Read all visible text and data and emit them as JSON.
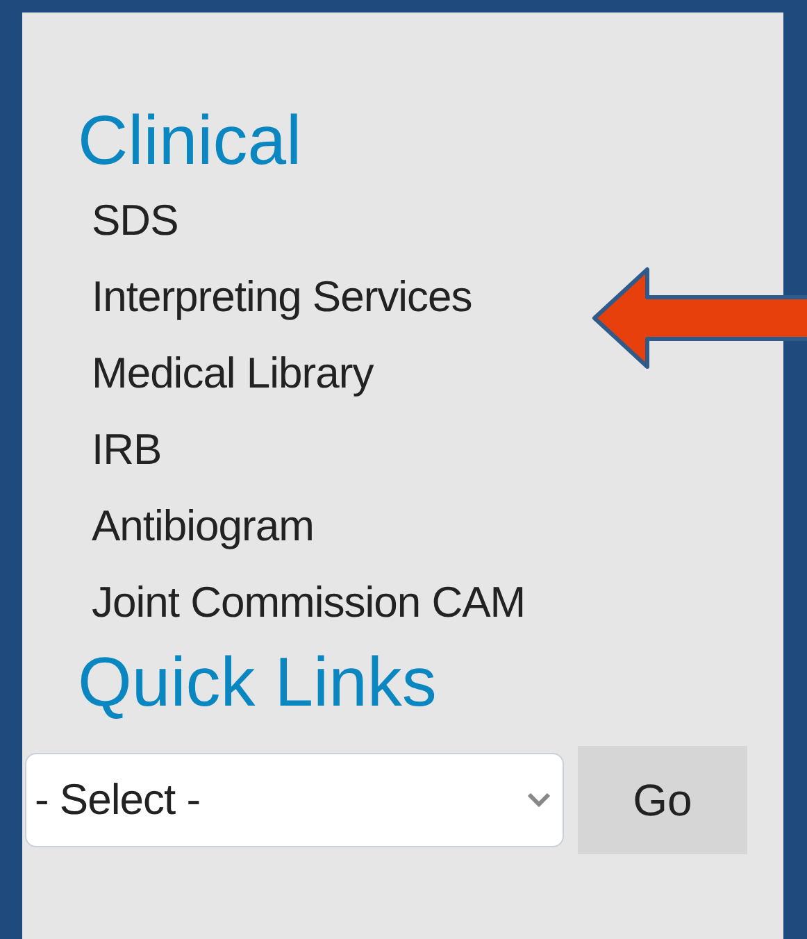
{
  "clinical": {
    "heading": "Clinical",
    "links": [
      "SDS",
      "Interpreting Services",
      "Medical Library",
      "IRB",
      "Antibiogram",
      "Joint Commission CAM"
    ]
  },
  "quick_links": {
    "heading": "Quick Links",
    "select": {
      "value": "- Select -"
    },
    "button": "Go"
  }
}
